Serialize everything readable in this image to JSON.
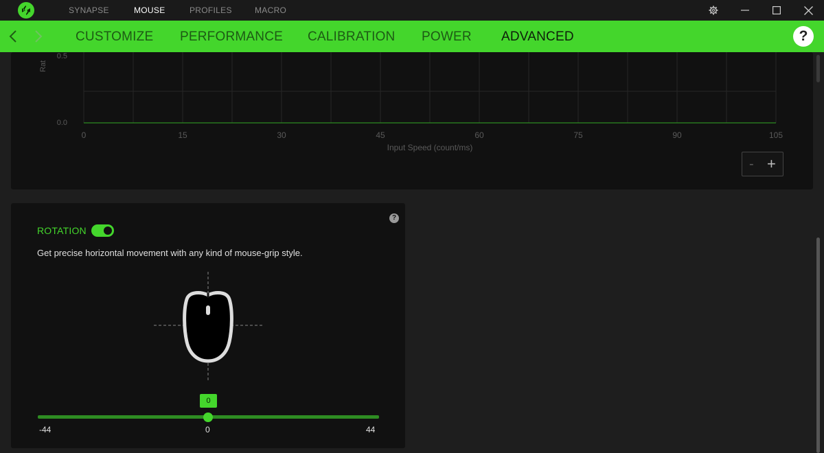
{
  "titlebar": {
    "tabs": [
      {
        "label": "SYNAPSE"
      },
      {
        "label": "MOUSE"
      },
      {
        "label": "PROFILES"
      },
      {
        "label": "MACRO"
      }
    ],
    "active_tab": "MOUSE",
    "icons": [
      "razer-logo-icon",
      "settings-gear-icon",
      "minimize-icon",
      "maximize-icon",
      "close-icon"
    ]
  },
  "subnav": {
    "tabs": [
      {
        "label": "CUSTOMIZE"
      },
      {
        "label": "PERFORMANCE"
      },
      {
        "label": "CALIBRATION"
      },
      {
        "label": "POWER"
      },
      {
        "label": "ADVANCED"
      }
    ],
    "active_tab": "ADVANCED",
    "help_label": "?",
    "accent_color": "#44d62c"
  },
  "accel_chart": {
    "y_label_partial": "Rat",
    "y_tick_partial": "0.5",
    "y_tick_zero": "0.0",
    "xlabel": "Input Speed (count/ms)",
    "x_ticks": [
      "0",
      "15",
      "30",
      "45",
      "60",
      "75",
      "90",
      "105"
    ],
    "minus_label": "-",
    "plus_label": "+"
  },
  "chart_data": {
    "type": "line",
    "xlabel": "Input Speed (count/ms)",
    "ylabel": "Rat",
    "x": [
      0,
      105
    ],
    "y": [
      0.0,
      0.0
    ],
    "xlim": [
      0,
      105
    ],
    "x_ticks": [
      0,
      15,
      30,
      45,
      60,
      75,
      90,
      105
    ],
    "grid": true
  },
  "rotation": {
    "title": "ROTATION",
    "enabled": true,
    "description": "Get precise horizontal movement with any kind of mouse-grip style.",
    "help_label": "?",
    "slider": {
      "min_label": "-44",
      "max_label": "44",
      "center_label": "0",
      "value_label": "0",
      "min": -44,
      "max": 44,
      "value": 0
    }
  }
}
